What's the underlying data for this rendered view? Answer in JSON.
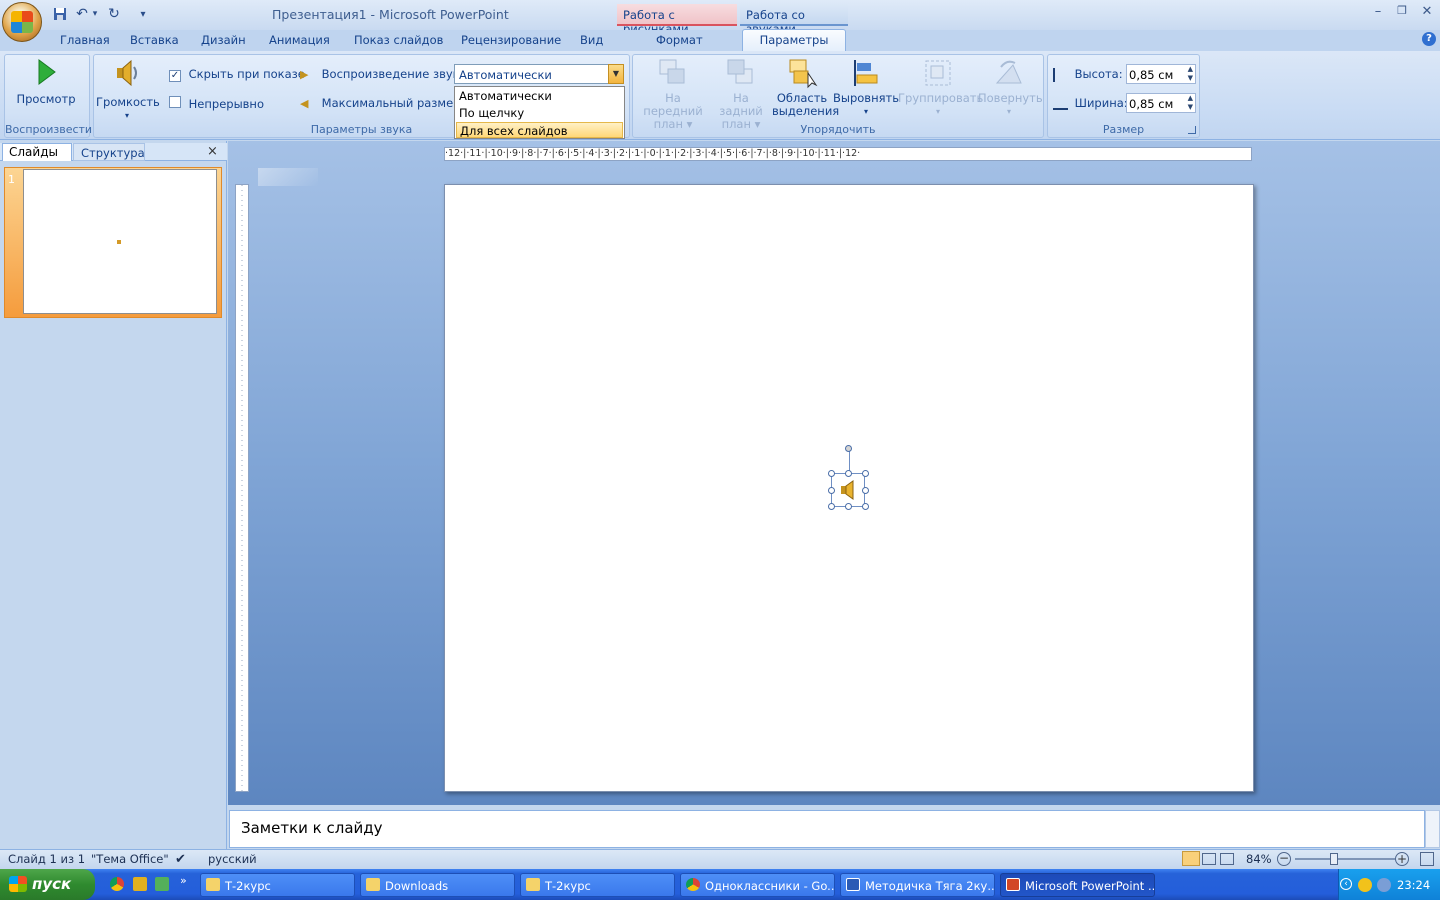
{
  "window": {
    "title": "Презентация1 - Microsoft PowerPoint",
    "contextual_tabs": [
      "Работа с рисунками",
      "Работа со звуками"
    ],
    "controls": {
      "minimize": "–",
      "maximize": "❐",
      "close": "✕"
    }
  },
  "quick_access": {
    "save": "save-icon",
    "undo": "undo-icon",
    "redo": "redo-icon",
    "customize": "▾"
  },
  "tabs": [
    "Главная",
    "Вставка",
    "Дизайн",
    "Анимация",
    "Показ слайдов",
    "Рецензирование",
    "Вид",
    "Формат",
    "Параметры"
  ],
  "ribbon": {
    "playback_group": {
      "label": "Воспроизвести",
      "preview": "Просмотр"
    },
    "volume": {
      "label": "Громкость"
    },
    "sound_params_group": {
      "label": "Параметры звука",
      "hide_during_show": "Скрыть при показе",
      "loop": "Непрерывно",
      "play_sound": "Воспроизведение звука:",
      "max_size": "Максимальный размер з",
      "play_combo_value": "Автоматически",
      "dropdown_options": [
        "Автоматически",
        "По щелчку",
        "Для всех слайдов"
      ]
    },
    "arrange_group": {
      "label": "Упорядочить",
      "bring_front": [
        "На передний",
        "план ▾"
      ],
      "send_back": [
        "На задний",
        "план ▾"
      ],
      "selection_pane": [
        "Область",
        "выделения"
      ],
      "align": "Выровнять",
      "group": "Группировать",
      "rotate": "Повернуть"
    },
    "size_group": {
      "label": "Размер",
      "height_label": "Высота:",
      "height_value": "0,85 см",
      "width_label": "Ширина:",
      "width_value": "0,85 см"
    }
  },
  "slides_pane": {
    "tab_slides": "Слайды",
    "tab_outline": "Структура",
    "close": "×",
    "slide_number": "1"
  },
  "ruler": {
    "horizontal": "·12·|·11·|·10·|·9·|·8·|·7·|·6·|·5·|·4·|·3·|·2·|·1·|·0·|·1·|·2·|·3·|·4·|·5·|·6·|·7·|·8·|·9·|·10·|·11·|·12·"
  },
  "notes": {
    "placeholder": "Заметки к слайду"
  },
  "status": {
    "slide": "Слайд 1 из 1",
    "theme": "\"Тема Office\"",
    "language": "русский",
    "zoom": "84%"
  },
  "taskbar": {
    "start": "пуск",
    "tasks": [
      "Т-2курс",
      "Downloads",
      "Т-2курс",
      "Одноклассники - Go...",
      "Методичка Тяга 2ку...",
      "Microsoft PowerPoint ..."
    ],
    "clock": "23:24"
  }
}
